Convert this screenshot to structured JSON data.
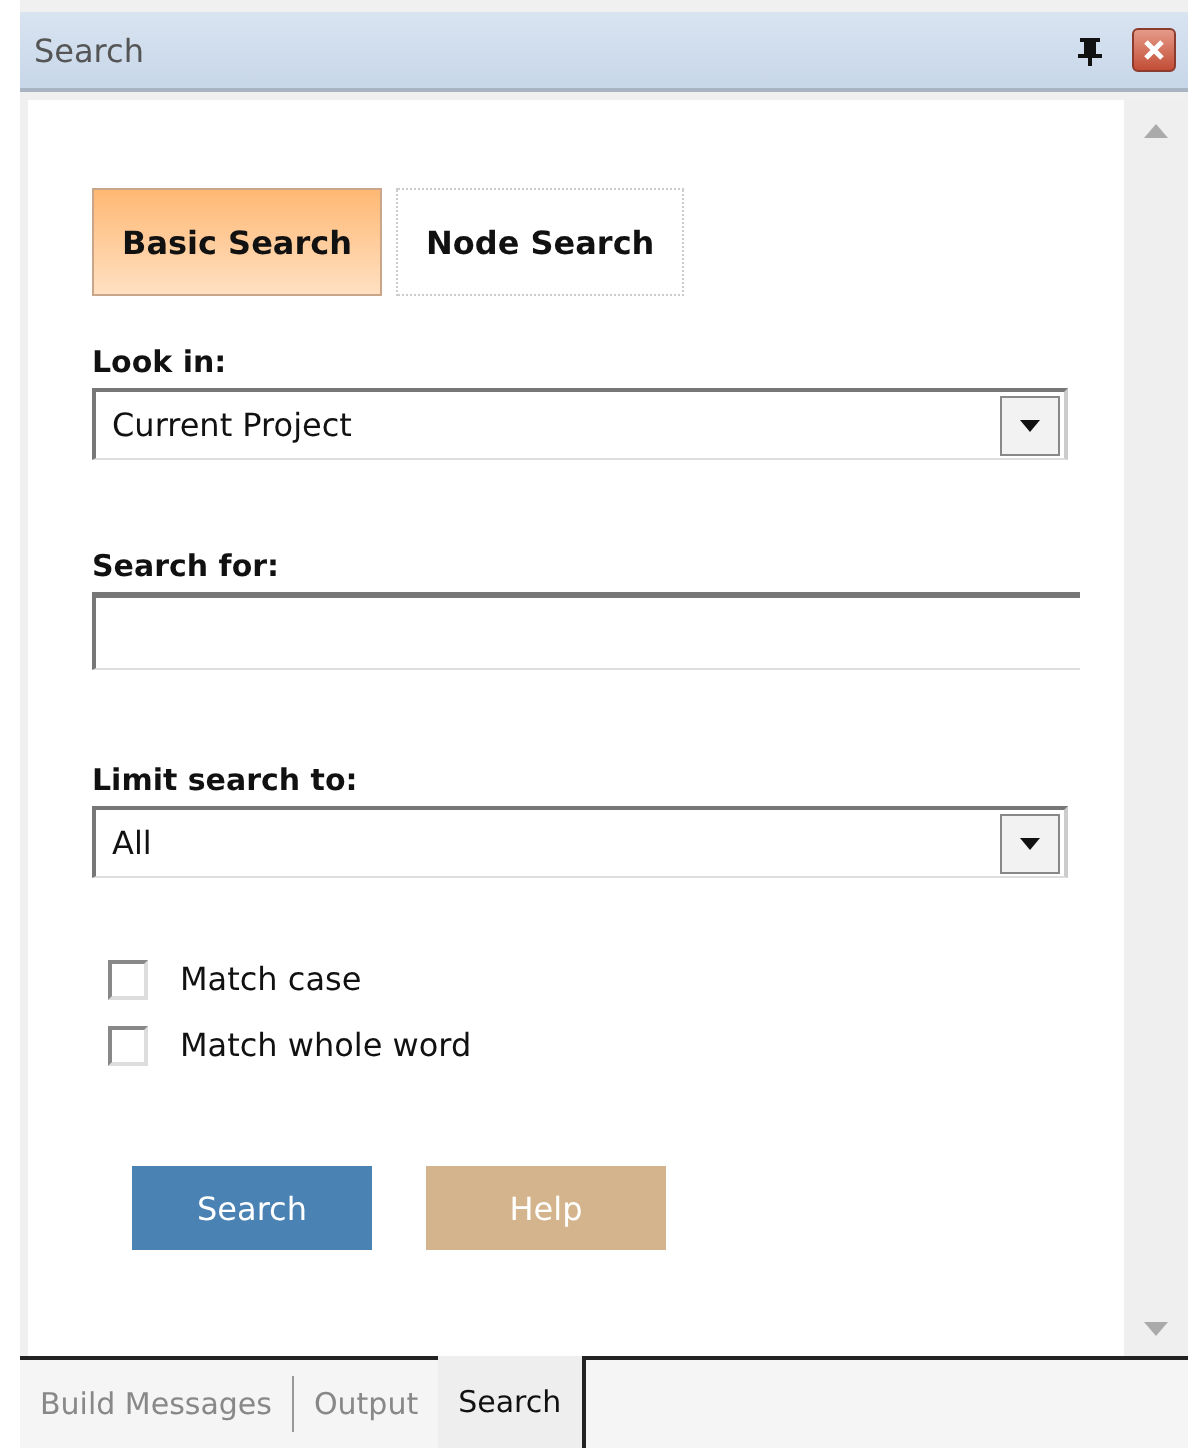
{
  "window": {
    "title": "Search"
  },
  "tabs": [
    {
      "label": "Basic Search",
      "selected": true
    },
    {
      "label": "Node Search",
      "selected": false
    }
  ],
  "look_in": {
    "label": "Look in:",
    "value": "Current Project"
  },
  "search_for": {
    "label": "Search for:"
  },
  "limit_search_to": {
    "label": "Limit search to:",
    "value": "All"
  },
  "options": [
    {
      "label": "Match case",
      "checked": false
    },
    {
      "label": "Match whole word",
      "checked": false
    }
  ],
  "buttons": [
    {
      "label": "Search",
      "kind": "primary"
    },
    {
      "label": "Help",
      "kind": "secondary"
    }
  ],
  "bottom_tabs": [
    {
      "label": "Build Messages",
      "selected": false
    },
    {
      "label": "Output",
      "selected": false
    },
    {
      "label": "Search",
      "selected": true
    }
  ]
}
